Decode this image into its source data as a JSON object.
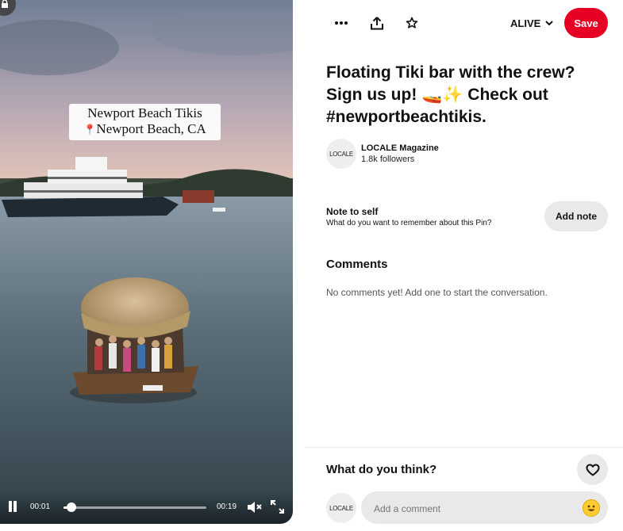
{
  "video": {
    "caption_line1": "Newport Beach Tikis",
    "caption_line2": "Newport Beach, CA",
    "current_time": "00:01",
    "duration": "00:19",
    "progress_fraction": 0.055,
    "muted": true,
    "lock_icon": "lock-icon"
  },
  "toolbar": {
    "more_icon": "more-icon",
    "share_icon": "share-icon",
    "favorite_icon": "star-icon",
    "board_name": "ALIVE",
    "save_label": "Save",
    "save_color": "#e60023"
  },
  "pin": {
    "title": "Floating Tiki bar with the crew? Sign us up! 🚤✨ Check out #newportbeachtikis."
  },
  "creator": {
    "avatar_text": "LOCALE",
    "name": "LOCALE Magazine",
    "followers": "1.8k followers"
  },
  "note": {
    "title": "Note to self",
    "subtitle": "What do you want to remember about this Pin?",
    "button_label": "Add note"
  },
  "comments": {
    "heading": "Comments",
    "empty_text": "No comments yet! Add one to start the conversation."
  },
  "feedback": {
    "heading": "What do you think?",
    "react_icon": "heart-icon",
    "avatar_text": "LOCALE",
    "input_placeholder": "Add a comment",
    "emoji_icon": "smiley-icon"
  }
}
